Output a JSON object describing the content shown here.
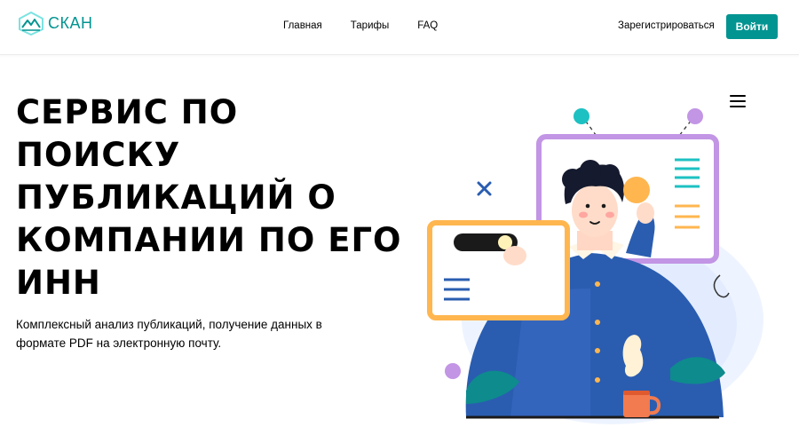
{
  "header": {
    "logo_text": "СКАН",
    "nav": [
      {
        "label": "Главная"
      },
      {
        "label": "Тарифы"
      },
      {
        "label": "FAQ"
      }
    ],
    "register_label": "Зарегистрироваться",
    "login_label": "Войти"
  },
  "hero": {
    "title": "СЕРВИС ПО ПОИСКУ ПУБЛИКАЦИЙ О КОМПАНИИ ПО ЕГО ИНН",
    "description": "Комплексный анализ публикаций, получение данных в формате PDF на электронную почту."
  },
  "icons": {
    "menu": "hamburger-icon",
    "logo": "mountain-logo-icon"
  },
  "colors": {
    "brand": "#029491",
    "purple_frame": "#C295E5",
    "orange_frame": "#FFB64F",
    "shirt_blue": "#2A5DB0",
    "teal": "#1DC1C2"
  }
}
